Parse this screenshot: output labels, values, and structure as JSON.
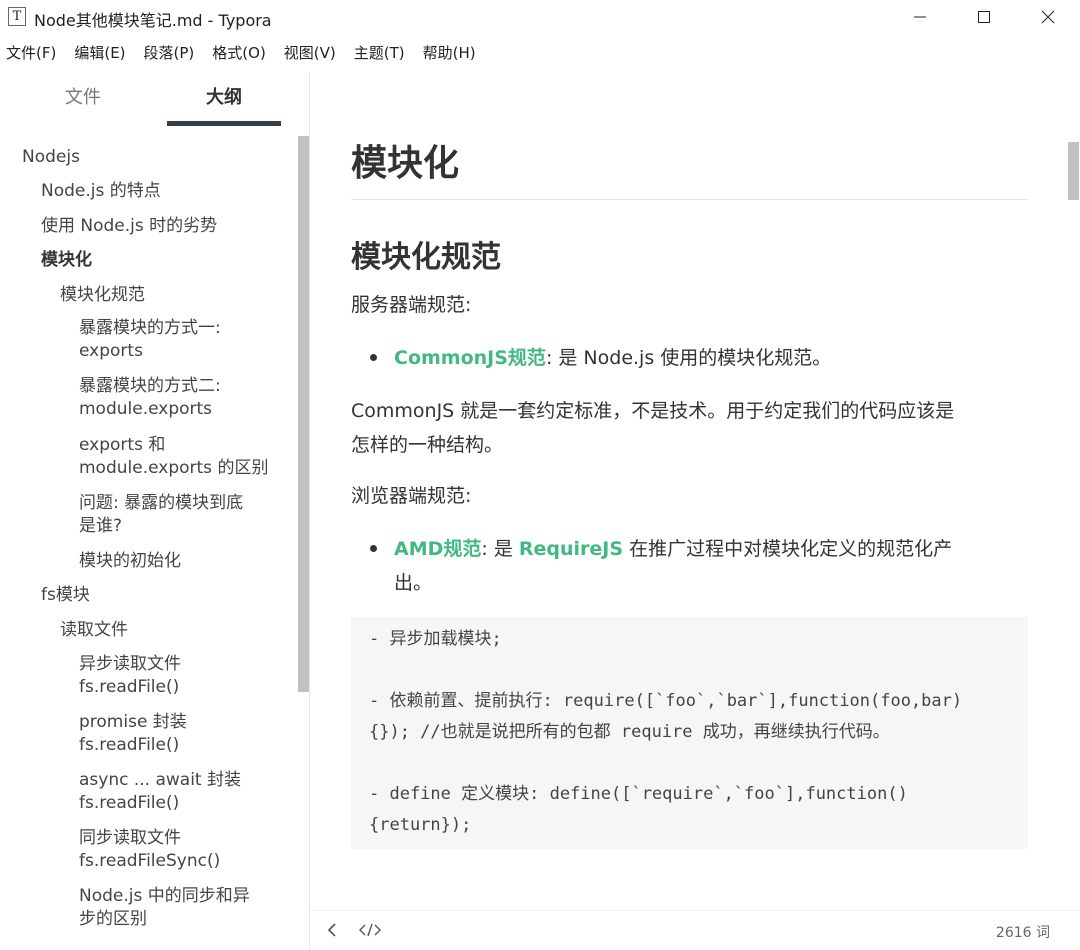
{
  "window": {
    "title": "Node其他模块笔记.md - Typora",
    "app_icon": "T"
  },
  "menu": [
    "文件(F)",
    "编辑(E)",
    "段落(P)",
    "格式(O)",
    "视图(V)",
    "主题(T)",
    "帮助(H)"
  ],
  "sidebar": {
    "tabs": {
      "files": "文件",
      "outline": "大纲"
    },
    "outline": [
      {
        "text": "Nodejs",
        "level": 1
      },
      {
        "text": "Node.js 的特点",
        "level": 2
      },
      {
        "text": "使用 Node.js 时的劣势",
        "level": 2
      },
      {
        "text": "模块化",
        "level": 2,
        "active": true
      },
      {
        "text": "模块化规范",
        "level": 3
      },
      {
        "text": "暴露模块的方式一:",
        "text2": "exports",
        "level": 4
      },
      {
        "text": "暴露模块的方式二:",
        "text2": "module.exports",
        "level": 4
      },
      {
        "text": "exports 和",
        "text2": "module.exports 的区别",
        "level": 4
      },
      {
        "text": "问题: 暴露的模块到底",
        "text2": "是谁?",
        "level": 4
      },
      {
        "text": "模块的初始化",
        "level": 4
      },
      {
        "text": "fs模块",
        "level": 2
      },
      {
        "text": "读取文件",
        "level": 3
      },
      {
        "text": "异步读取文件",
        "text2": "fs.readFile()",
        "level": 4
      },
      {
        "text": "promise 封装",
        "text2": "fs.readFile()",
        "level": 4
      },
      {
        "text": "async ... await 封装",
        "text2": "fs.readFile()",
        "level": 4
      },
      {
        "text": "同步读取文件",
        "text2": "fs.readFileSync()",
        "level": 4
      },
      {
        "text": "Node.js 中的同步和异",
        "text2": "步的区别",
        "level": 4
      }
    ]
  },
  "doc": {
    "h1": "模块化",
    "h2": "模块化规范",
    "server_spec": "服务器端规范:",
    "li1_link": "CommonJS规范",
    "li1_rest": ": 是 Node.js 使用的模块化规范。",
    "para1_line1": "CommonJS 就是一套约定标准，不是技术。用于约定我们的代码应该是",
    "para1_line2": "怎样的一种结构。",
    "browser_spec": "浏览器端规范:",
    "li2_link": "AMD规范",
    "li2_mid": ": 是 ",
    "li2_link2": "RequireJS",
    "li2_rest": " 在推广过程中对模块化定义的规范化产",
    "li2_rest2": "出。",
    "code_lines": [
      "- 异步加载模块;",
      "",
      "- 依赖前置、提前执行: require([`foo`,`bar`],function(foo,bar)",
      "{});   //也就是说把所有的包都 require 成功，再继续执行代码。",
      "",
      "- define 定义模块: define([`require`,`foo`],function()",
      "{return});"
    ]
  },
  "status": {
    "word_count": "2616 词"
  },
  "colors": {
    "accent": "#42b983",
    "tab_underline": "#333f4a"
  }
}
